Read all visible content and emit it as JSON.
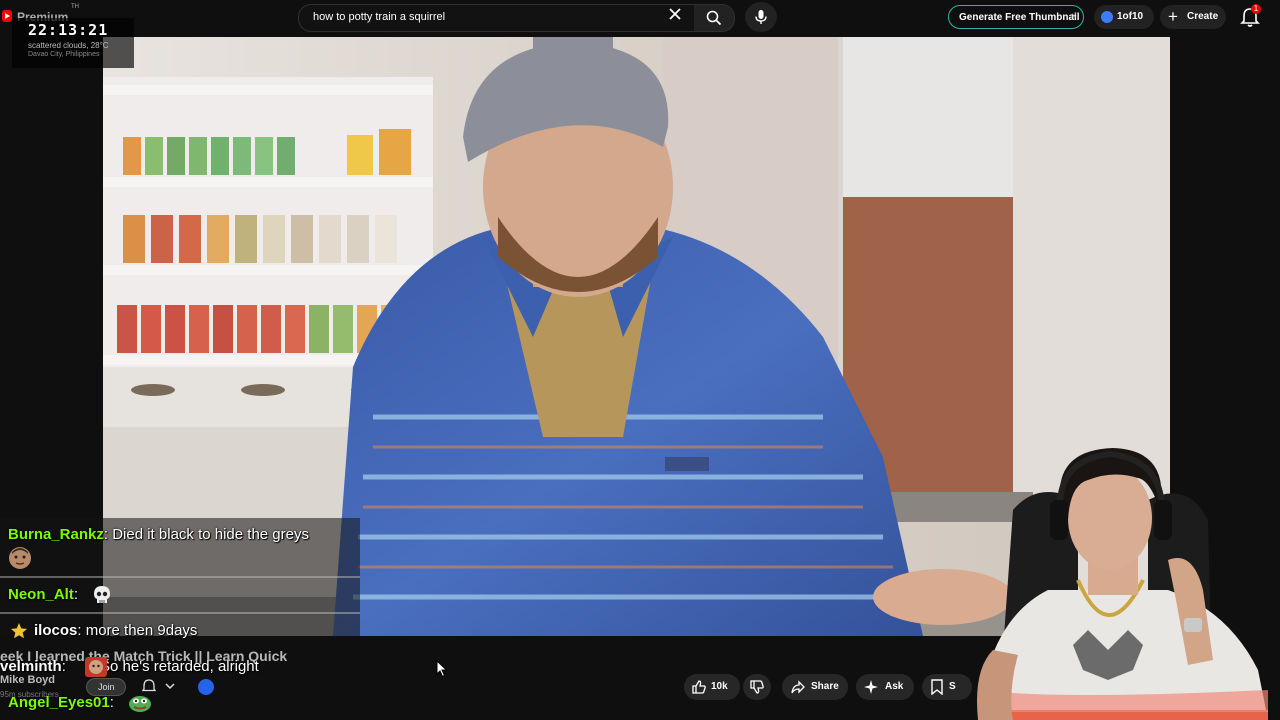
{
  "brand": {
    "label": "Premium",
    "sup": "TH"
  },
  "clock": {
    "time": "22:13:21",
    "weather": "scattered clouds, 28°C",
    "location": "Davao City, Philippines"
  },
  "search": {
    "query": "how to potty train a squirrel",
    "placeholder": "Search"
  },
  "header_actions": {
    "generate_thumbnail": "Generate Free Thumbnail",
    "close": "×",
    "count": "1of10",
    "create": "Create",
    "notification_count": "1"
  },
  "video": {
    "title_partial": "eek I learned the Match Trick || Learn Quick",
    "channel": "Mike Boyd",
    "subscribers": "95m subscribers",
    "join_label": "Join",
    "likes": "10k",
    "share_label": "Share",
    "ask_label": "Ask",
    "save_label": "S"
  },
  "chat": {
    "messages": [
      {
        "user": "Burna_Rankz",
        "text": "Died it black to hide the greys",
        "emote": "face-emote"
      },
      {
        "user": "Neon_Alt",
        "text": "",
        "emote": "skull-emote"
      },
      {
        "user": "ilocos",
        "text": "more then 9days",
        "badge": "star-badge"
      },
      {
        "user": "velminth",
        "text": "So he's retarded, alright",
        "emote": "face-emote"
      },
      {
        "user": "Angel_Eyes01",
        "text": "",
        "emote": "pepe-emote"
      }
    ]
  },
  "colors": {
    "chat_user": "#7cfc00",
    "accent_red": "#ff0000",
    "thumb_border": "#2fb5a6",
    "badge_blue": "#2563eb"
  }
}
